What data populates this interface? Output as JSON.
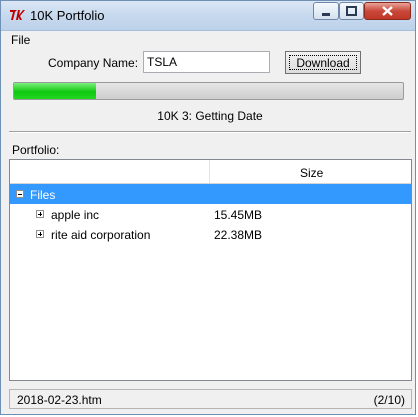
{
  "window": {
    "title": "10K Portfolio",
    "icon": "tk-feather-icon"
  },
  "menu": {
    "items": [
      "File"
    ]
  },
  "form": {
    "company_label": "Company Name:",
    "company_value": "TSLA",
    "download_label": "Download"
  },
  "progress": {
    "fraction": 0.21,
    "color": "#18c818"
  },
  "status_text": "10K 3: Getting Date",
  "portfolio": {
    "label": "Portfolio:",
    "columns": [
      "",
      "Size"
    ],
    "root": {
      "label": "Files",
      "expanded": true,
      "selected": true
    },
    "items": [
      {
        "name": "apple inc",
        "size": "15.45MB",
        "expanded": false
      },
      {
        "name": "rite aid corporation",
        "size": "22.38MB",
        "expanded": false
      }
    ]
  },
  "statusbar": {
    "file": "2018-02-23.htm",
    "position": "(2/10)"
  },
  "colors": {
    "selection": "#3399ff",
    "progress_fill": "#18c818",
    "close_button": "#c9483a"
  }
}
